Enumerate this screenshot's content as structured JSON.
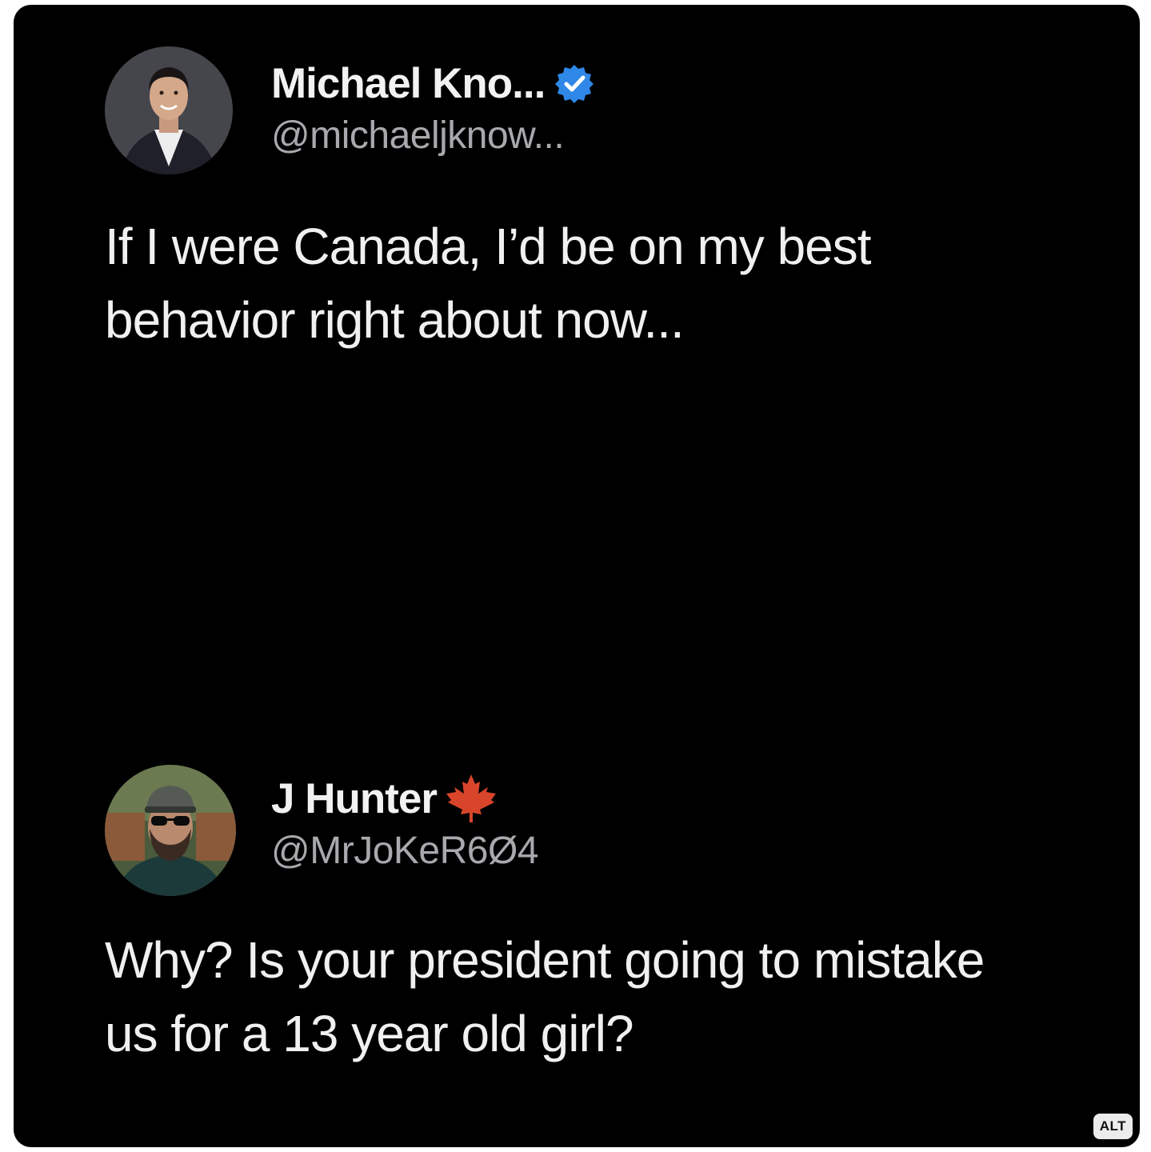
{
  "posts": [
    {
      "display_name": "Michael Kno...",
      "handle": "@michaeljknow...",
      "verified": true,
      "verified_color": "#2f87e8",
      "text": "If I were Canada, I’d be on my best behavior right about now..."
    },
    {
      "display_name": "J Hunter",
      "handle": "@MrJoKeR6Ø4",
      "name_emoji": "maple-leaf-icon",
      "emoji_color": "#d9452b",
      "text": "Why? Is your president going to mistake us for a 13 year old girl?"
    }
  ],
  "alt_label": "ALT",
  "colors": {
    "background": "#000000",
    "text_primary": "#f0f0f0",
    "text_secondary": "#a7a9ad"
  }
}
